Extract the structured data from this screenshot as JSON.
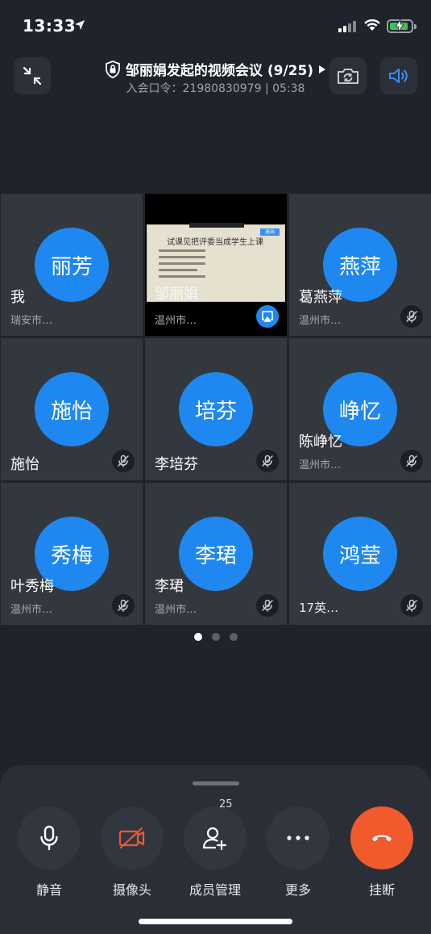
{
  "status": {
    "time": "13:33"
  },
  "header": {
    "title": "邹丽娟发起的视频会议 (9/25)",
    "subtitle": "入会口令：21980830979 | 05:38"
  },
  "tiles": [
    {
      "avatar": "丽芳",
      "name": "我",
      "location": "瑞安市…",
      "mic": "none"
    },
    {
      "avatar": "",
      "name": "邹丽娟",
      "location": "温州市…",
      "mic": "share"
    },
    {
      "avatar": "燕萍",
      "name": "葛燕萍",
      "location": "温州市…",
      "mic": "muted"
    },
    {
      "avatar": "施怡",
      "name": "施怡",
      "location": "",
      "mic": "muted"
    },
    {
      "avatar": "培芬",
      "name": "李培芬",
      "location": "",
      "mic": "muted"
    },
    {
      "avatar": "峥忆",
      "name": "陈峥忆",
      "location": "温州市…",
      "mic": "muted"
    },
    {
      "avatar": "秀梅",
      "name": "叶秀梅",
      "location": "温州市…",
      "mic": "muted"
    },
    {
      "avatar": "李珺",
      "name": "李珺",
      "location": "温州市…",
      "mic": "muted"
    },
    {
      "avatar": "鸿莹",
      "name": "",
      "location": "17英…",
      "mic": "muted"
    }
  ],
  "shared_screen": {
    "slide_title": "试课见把评委当成学生上课",
    "button_label": "退出"
  },
  "pager": {
    "pages": 3,
    "active": 0
  },
  "controls": {
    "mute": "静音",
    "camera": "摄像头",
    "members": "成员管理",
    "member_count": "25",
    "more": "更多",
    "hangup": "挂断"
  },
  "colors": {
    "avatar": "#1e88f0",
    "hangup": "#f05a2d",
    "camera_off": "#f05a2d",
    "speaker_accent": "#3d8ff5"
  }
}
